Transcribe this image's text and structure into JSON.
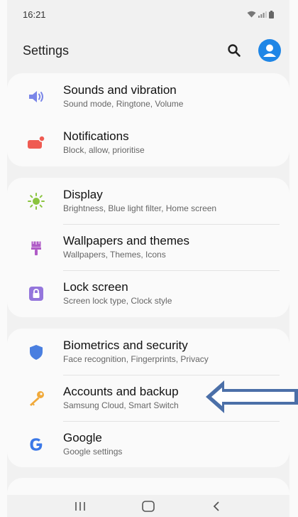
{
  "status_bar": {
    "time": "16:21"
  },
  "header": {
    "title": "Settings"
  },
  "groups": [
    {
      "items": [
        {
          "title": "Sounds and vibration",
          "subtitle": "Sound mode, Ringtone, Volume",
          "icon": "speaker-icon",
          "color": "#7a86e8"
        },
        {
          "title": "Notifications",
          "subtitle": "Block, allow, prioritise",
          "icon": "notification-badge-icon",
          "color": "#ef5b52"
        }
      ]
    },
    {
      "items": [
        {
          "title": "Display",
          "subtitle": "Brightness, Blue light filter, Home screen",
          "icon": "sun-icon",
          "color": "#8bc43f"
        },
        {
          "title": "Wallpapers and themes",
          "subtitle": "Wallpapers, Themes, Icons",
          "icon": "paintbrush-icon",
          "color": "#b05cc7"
        },
        {
          "title": "Lock screen",
          "subtitle": "Screen lock type, Clock style",
          "icon": "lock-icon",
          "color": "#9476dc"
        }
      ]
    },
    {
      "items": [
        {
          "title": "Biometrics and security",
          "subtitle": "Face recognition, Fingerprints, Privacy",
          "icon": "shield-icon",
          "color": "#4a7fe0"
        },
        {
          "title": "Accounts and backup",
          "subtitle": "Samsung Cloud, Smart Switch",
          "icon": "key-icon",
          "color": "#f0a93a"
        },
        {
          "title": "Google",
          "subtitle": "Google settings",
          "icon": "google-icon",
          "color": "#3b78e7"
        }
      ]
    }
  ],
  "colors": {
    "accent": "#1f86e6",
    "arrow": "#4b6fa8",
    "background": "#f1f1f1",
    "card": "#fafafa"
  }
}
